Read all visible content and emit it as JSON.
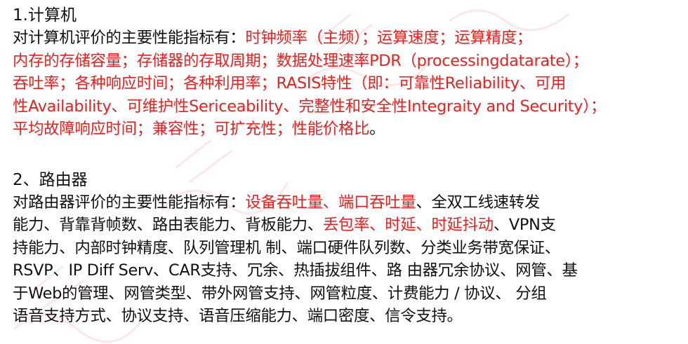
{
  "section1": {
    "heading": "1.计算机",
    "lines": [
      [
        {
          "text": "对计算机评价的主要性能指标有：",
          "red": false
        },
        {
          "text": "时钟频率（主频）；运算速度；运算精度；",
          "red": true
        }
      ],
      [
        {
          "text": "内存的存储容量；存储器的存取周期；数据处理速率PDR（processingdatarate）；",
          "red": true
        }
      ],
      [
        {
          "text": "吞吐率；各种响应时间；各种利用率；RASIS特性（即：可靠性Reliability、可用",
          "red": true
        }
      ],
      [
        {
          "text": "性Availability、可维护性Sericeability、完整性和安全性Integraity and Security）；",
          "red": true
        }
      ],
      [
        {
          "text": "平均故障响应时间；兼容性；可扩充性；性能价格比",
          "red": true
        },
        {
          "text": "。",
          "red": false
        }
      ]
    ]
  },
  "section2": {
    "heading": "2、路由器",
    "lines": [
      [
        {
          "text": "对路由器评价的主要性能指标有：",
          "red": false
        },
        {
          "text": "设备吞吐量、端口吞吐量",
          "red": true
        },
        {
          "text": "、全双工线速转发",
          "red": false
        }
      ],
      [
        {
          "text": "能力、背靠背帧数、路由表能力、背板能力、",
          "red": false
        },
        {
          "text": "丢包率、时延、时延抖动",
          "red": true
        },
        {
          "text": "、VPN支",
          "red": false
        }
      ],
      [
        {
          "text": "持能力、内部时钟精度、队列管理机 制、端口硬件队列数、分类业务带宽保证、",
          "red": false
        }
      ],
      [
        {
          "text": "RSVP、IP Diff Serv、CAR支持、冗余、热插拔组件、路 由器冗余协议、网管、基",
          "red": false
        }
      ],
      [
        {
          "text": "于Web的管理、网管类型、带外网管支持、网管粒度、计费能力 / 协议、 分组",
          "red": false
        }
      ],
      [
        {
          "text": "语音支持方式、协议支持、语音压缩能力、端口密度、信令支持。",
          "red": false
        }
      ]
    ]
  },
  "colors": {
    "text": "#111111",
    "highlight": "#e8211e",
    "watermark": "#e8211e"
  }
}
